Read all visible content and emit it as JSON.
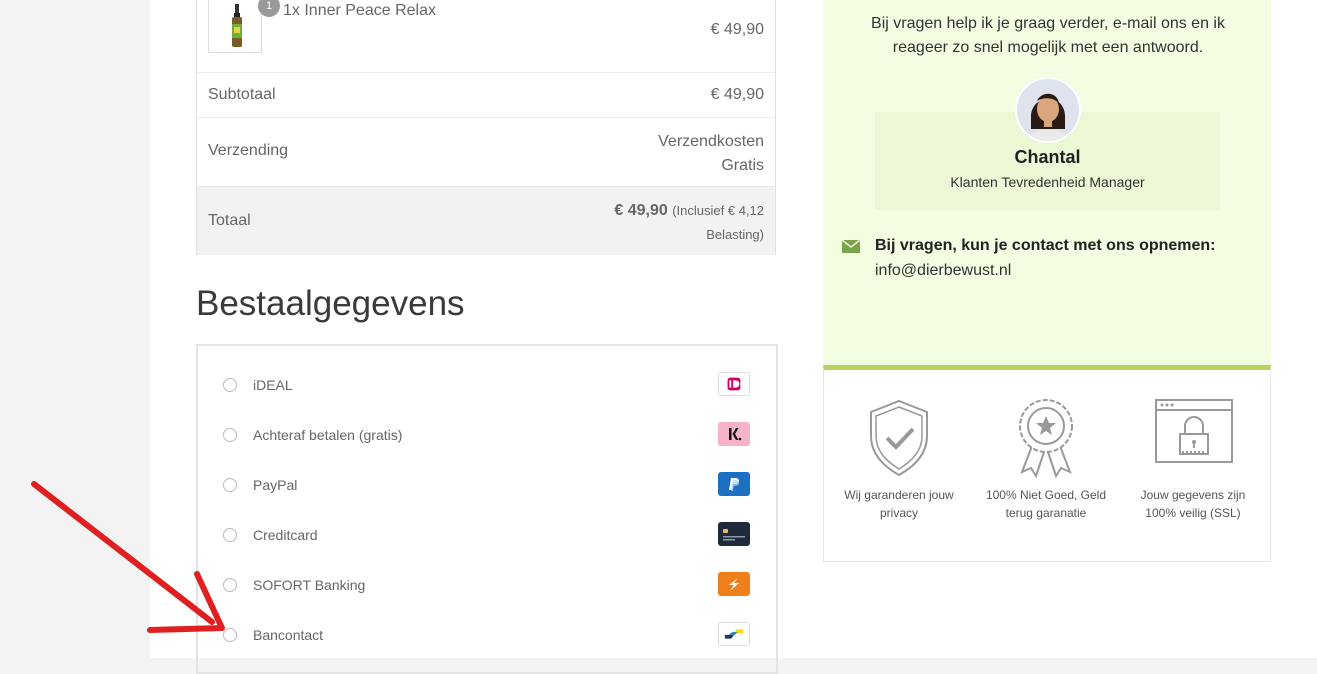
{
  "order": {
    "product": {
      "name": "1x Inner Peace Relax",
      "qty": "1",
      "price": "€ 49,90"
    },
    "subtotal_label": "Subtotaal",
    "subtotal_value": "€ 49,90",
    "shipping_label": "Verzending",
    "shipping_line1": "Verzendkosten",
    "shipping_line2": "Gratis",
    "total_label": "Totaal",
    "total_value": "€ 49,90",
    "tax_line1": "(Inclusief € 4,12",
    "tax_line2": "Belasting)"
  },
  "payment": {
    "heading": "Bestaalgegevens",
    "methods": [
      {
        "label": "iDEAL",
        "icon": "ideal-icon"
      },
      {
        "label": "Achteraf betalen (gratis)",
        "icon": "klarna-icon"
      },
      {
        "label": "PayPal",
        "icon": "paypal-icon"
      },
      {
        "label": "Creditcard",
        "icon": "creditcard-icon"
      },
      {
        "label": "SOFORT Banking",
        "icon": "sofort-icon"
      },
      {
        "label": "Bancontact",
        "icon": "bancontact-icon"
      }
    ]
  },
  "help": {
    "text": "Bij vragen help ik je graag verder, e-mail ons en ik reageer zo snel mogelijk met een antwoord.",
    "manager_name": "Chantal",
    "manager_title": "Klanten Tevredenheid Manager",
    "contact_heading": "Bij vragen, kun je contact met ons opnemen:",
    "contact_email": "info@dierbewust.nl"
  },
  "guarantees": [
    {
      "icon": "shield-check-icon",
      "line1": "Wij garanderen jouw",
      "line2": "privacy"
    },
    {
      "icon": "award-ribbon-icon",
      "line1": "100% Niet Goed, Geld",
      "line2": "terug garanatie"
    },
    {
      "icon": "ssl-lock-icon",
      "line1": "Jouw gegevens zijn",
      "line2": "100% veilig (SSL)"
    }
  ],
  "colors": {
    "help_bg": "#f3fde1",
    "accent_green": "#b7d35c",
    "annotation_arrow": "#e02020"
  }
}
